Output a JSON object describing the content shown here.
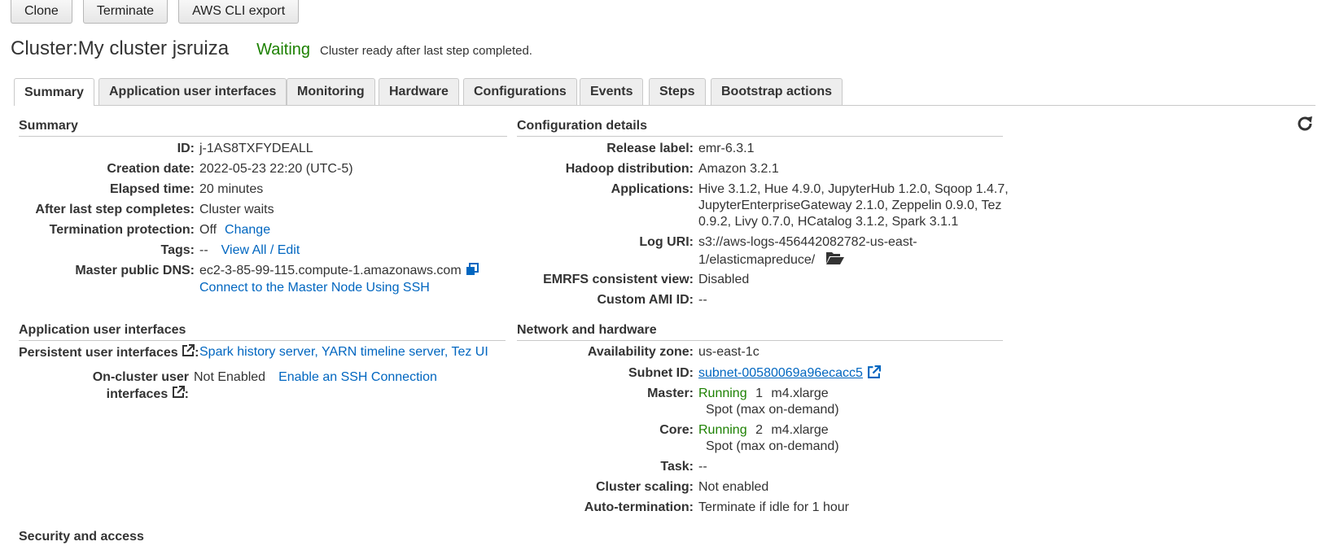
{
  "toolbar": {
    "clone": "Clone",
    "terminate": "Terminate",
    "cli_export": "AWS CLI export"
  },
  "header": {
    "title_prefix": "Cluster: ",
    "cluster_name": "My cluster jsruiza",
    "status": "Waiting",
    "status_message": "Cluster ready after last step completed."
  },
  "tabs": [
    "Summary",
    "Application user interfaces",
    "Monitoring",
    "Hardware",
    "Configurations",
    "Events",
    "Steps",
    "Bootstrap actions"
  ],
  "summary": {
    "title": "Summary",
    "id_label": "ID:",
    "id": "j-1AS8TXFYDEALL",
    "creation_label": "Creation date:",
    "creation": "2022-05-23 22:20 (UTC-5)",
    "elapsed_label": "Elapsed time:",
    "elapsed": "20 minutes",
    "after_label": "After last step completes:",
    "after": "Cluster waits",
    "protection_label": "Termination protection:",
    "protection": "Off",
    "protection_link": "Change",
    "tags_label": "Tags:",
    "tags": "--",
    "tags_link": "View All / Edit",
    "dns_label": "Master public DNS:",
    "dns": "ec2-3-85-99-115.compute-1.amazonaws.com",
    "ssh_link": "Connect to the Master Node Using SSH"
  },
  "config": {
    "title": "Configuration details",
    "release_label": "Release label:",
    "release": "emr-6.3.1",
    "hadoop_label": "Hadoop distribution:",
    "hadoop": "Amazon 3.2.1",
    "apps_label": "Applications:",
    "apps_line1": "Hive 3.1.2, Hue 4.9.0, JupyterHub 1.2.0, Sqoop 1.4.7,",
    "apps_line2": "JupyterEnterpriseGateway 2.1.0, Zeppelin 0.9.0, Tez",
    "apps_line3": "0.9.2, Livy 0.7.0, HCatalog 3.1.2, Spark 3.1.1",
    "log_label": "Log URI:",
    "log_line1": "s3://aws-logs-456442082782-us-east-",
    "log_line2": "1/elasticmapreduce/",
    "emrfs_label": "EMRFS consistent view:",
    "emrfs": "Disabled",
    "ami_label": "Custom AMI ID:",
    "ami": "--"
  },
  "appui": {
    "title": "Application user interfaces",
    "persistent_label": "Persistent user interfaces",
    "persistent_value": "Spark history server, YARN timeline server, Tez UI",
    "oncluster_label1": "On-cluster user",
    "oncluster_label2": "interfaces",
    "oncluster_value": "Not Enabled",
    "oncluster_link": "Enable an SSH Connection"
  },
  "network": {
    "title": "Network and hardware",
    "az_label": "Availability zone:",
    "az": "us-east-1c",
    "subnet_label": "Subnet ID:",
    "subnet": "subnet-00580069a96ecacc5",
    "master_label": "Master:",
    "master_status": "Running",
    "master_count": "1",
    "master_type": "m4.xlarge",
    "master_market": "Spot (max on-demand)",
    "core_label": "Core:",
    "core_status": "Running",
    "core_count": "2",
    "core_type": "m4.xlarge",
    "core_market": "Spot (max on-demand)",
    "task_label": "Task:",
    "task": "--",
    "scaling_label": "Cluster scaling:",
    "scaling": "Not enabled",
    "autoterm_label": "Auto-termination:",
    "autoterm": "Terminate if idle for 1 hour"
  },
  "security": {
    "title": "Security and access"
  },
  "colors": {
    "link": "#0066c0",
    "success": "#1d8102",
    "text": "#333333",
    "border": "#c9c9c9"
  },
  "icons": {
    "refresh": "refresh-icon",
    "copy": "copy-icon",
    "external": "external-link-icon",
    "folder": "folder-open-icon"
  }
}
